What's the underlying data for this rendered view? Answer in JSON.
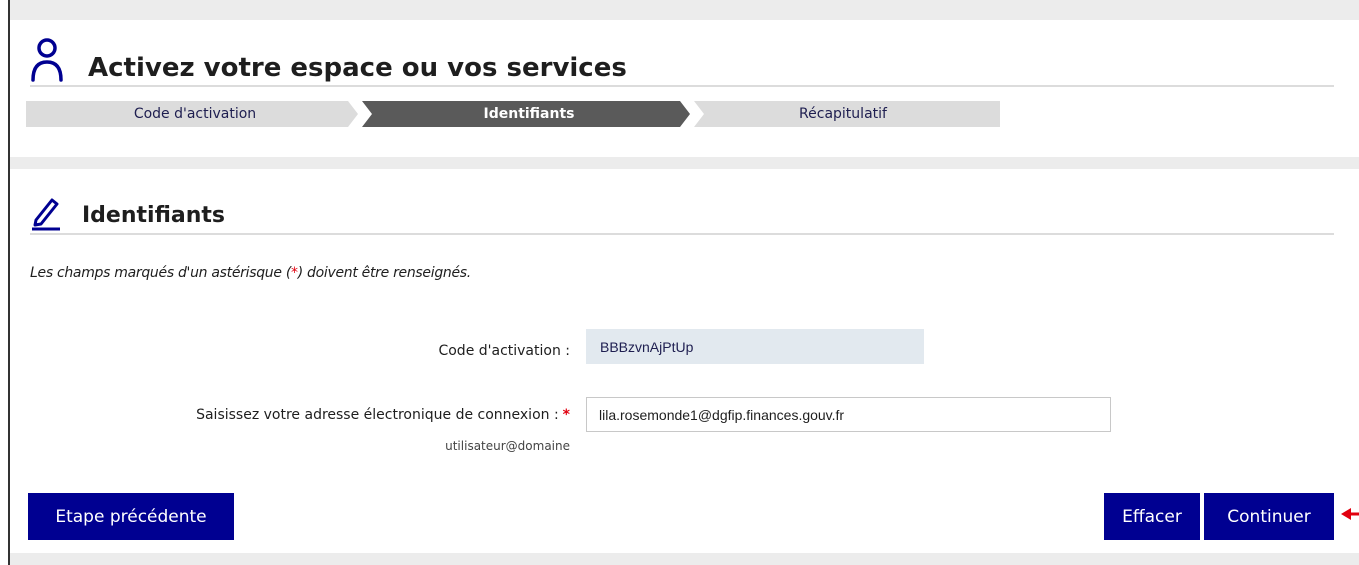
{
  "header": {
    "title": "Activez votre espace ou vos services"
  },
  "stepper": {
    "steps": [
      {
        "label": "Code d'activation",
        "state": "done"
      },
      {
        "label": "Identifiants",
        "state": "active"
      },
      {
        "label": "Récapitulatif",
        "state": "todo"
      }
    ]
  },
  "section": {
    "title": "Identifiants"
  },
  "form": {
    "required_note_before": "Les champs marqués d'un astérisque (",
    "required_note_asterisk": "*",
    "required_note_after": ") doivent être renseignés.",
    "activation_code": {
      "label": "Code d'activation :",
      "value": "BBBzvnAjPtUp"
    },
    "email": {
      "label": "Saisissez votre adresse électronique de connexion :",
      "required_mark": "*",
      "value": "lila.rosemonde1@dgfip.finances.gouv.fr",
      "hint": "utilisateur@domaine"
    }
  },
  "actions": {
    "previous_label": "Etape précédente",
    "clear_label": "Effacer",
    "continue_label": "Continuer"
  },
  "colors": {
    "primary": "#000091",
    "required": "#e1000f",
    "step_active": "#5a5a5a",
    "step_inactive": "#dcdcdc",
    "readonly_field": "#e2e9ef"
  },
  "icons": {
    "header": "user-icon",
    "section": "pencil-icon",
    "pointer": "red-arrow-icon"
  }
}
